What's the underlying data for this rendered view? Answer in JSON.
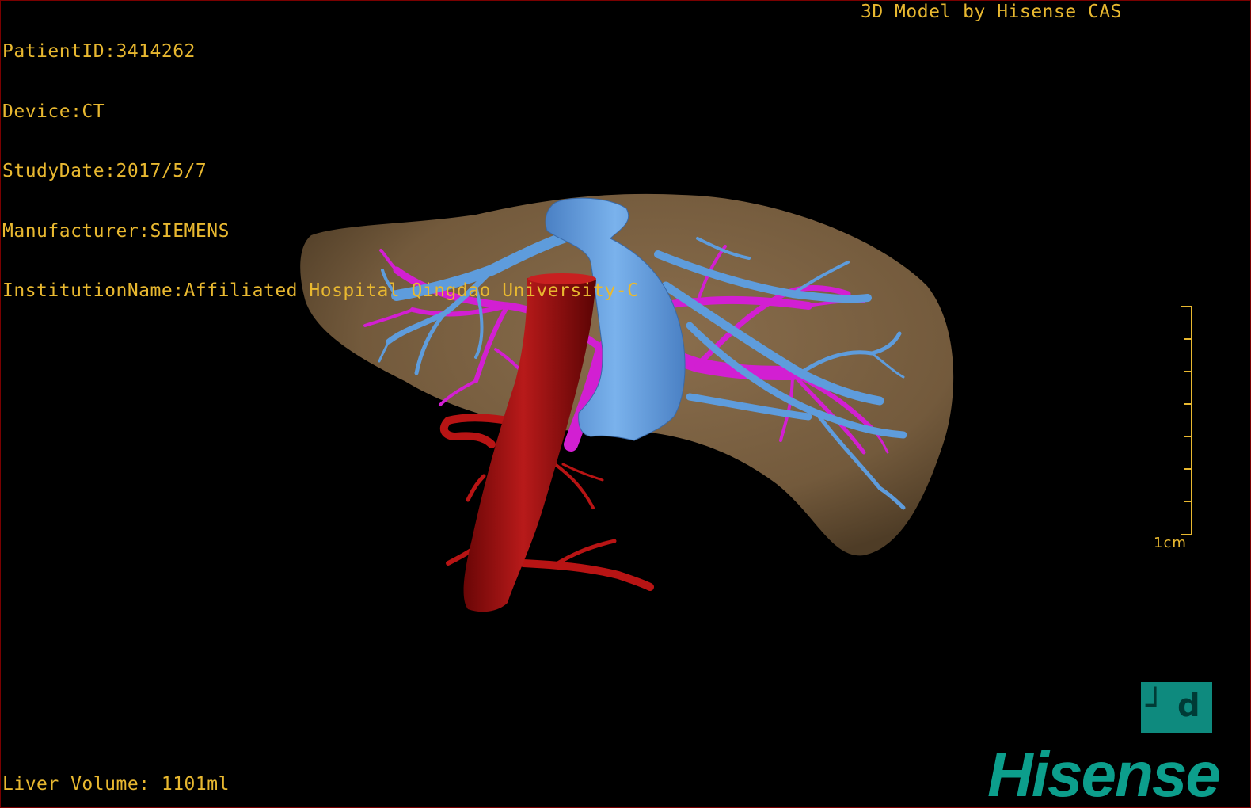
{
  "overlay": {
    "patient_id": "PatientID:3414262",
    "device": "Device:CT",
    "study_date": "StudyDate:2017/5/7",
    "manufacturer": "Manufacturer:SIEMENS",
    "institution": "InstitutionName:Affiliated Hospital Qingdao University-C",
    "model_credit": "3D Model by Hisense CAS",
    "liver_volume": "Liver Volume: 1101ml"
  },
  "scale_bar": {
    "label": "1cm"
  },
  "branding": {
    "logo_text": "Hisense",
    "pd_icon": "pd-monogram-icon"
  },
  "colors": {
    "overlay_text": "#e8b830",
    "liver": "#7d6345",
    "hepatic_vein": "#5b9ad8",
    "portal_vein": "#d020d0",
    "artery": "#a01010",
    "brand": "#0c9e8c"
  }
}
